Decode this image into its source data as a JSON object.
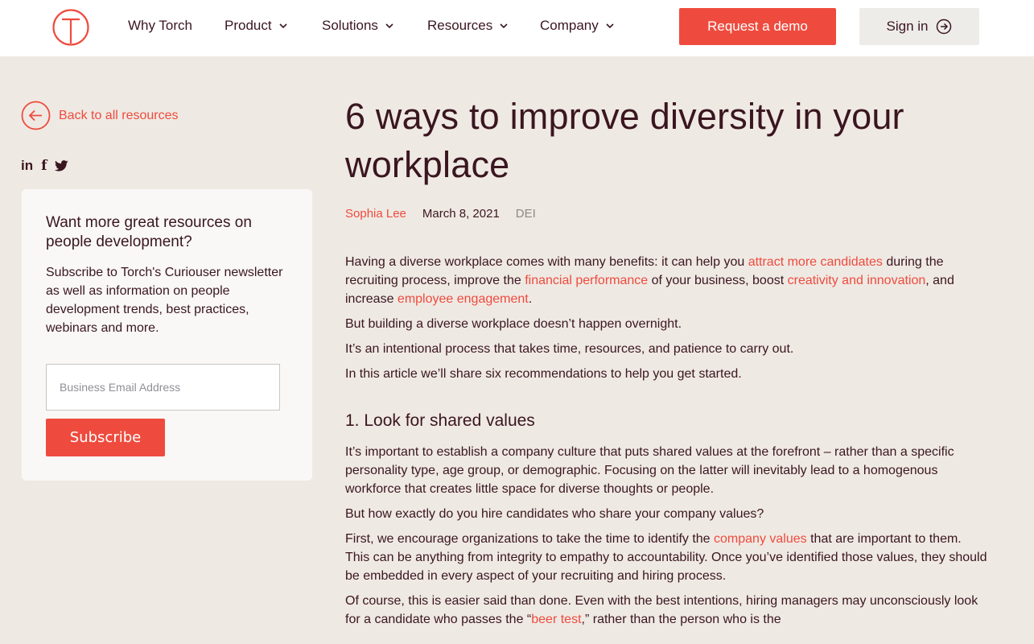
{
  "nav": {
    "items": [
      {
        "label": "Why Torch"
      },
      {
        "label": "Product"
      },
      {
        "label": "Solutions"
      },
      {
        "label": "Resources"
      },
      {
        "label": "Company"
      }
    ],
    "demo_label": "Request a demo",
    "signin_label": "Sign in",
    "logo_letter": "T"
  },
  "sidebar": {
    "back_label": "Back to all resources",
    "social": {
      "linkedin": "in",
      "facebook": "f",
      "twitter": "twitter-icon"
    },
    "card": {
      "heading": "Want more great resources on people development?",
      "text": "Subscribe to Torch's Curiouser newsletter as well as information on people development trends, best practices, webinars and more.",
      "email_placeholder": "Business Email Address",
      "subscribe_label": "Subscribe"
    }
  },
  "article": {
    "title": "6 ways to improve diversity in your workplace",
    "author": "Sophia Lee",
    "date": "March 8, 2021",
    "tag": "DEI",
    "intro": {
      "t1": "Having a diverse workplace comes with many benefits: it can help you ",
      "l1": "attract more candidates",
      "t2": " during the recruiting process, improve the ",
      "l2": "financial performance",
      "t3": " of your business, boost ",
      "l3": "creativity and innovation",
      "t4": ", and increase ",
      "l4": "employee engagement",
      "t5": "."
    },
    "p2": "But building a diverse workplace doesn’t happen overnight.",
    "p3": "It’s an intentional process that takes time, resources, and patience to carry out.",
    "p4": "In this article we’ll share six recommendations to help you get started.",
    "h1": "1. Look for shared values",
    "s1p1": "It’s important to establish a company culture that puts shared values at the forefront – rather than a specific personality type, age group, or demographic. Focusing on the latter will inevitably lead to a homogenous workforce that creates little space for diverse thoughts or people.",
    "s1p2": "But how exactly do you hire candidates who share your company values?",
    "s1p3": {
      "t1": "First, we encourage organizations to take the time to identify the ",
      "l1": "company values",
      "t2": " that are important to them. This can be anything from integrity to empathy to accountability. Once you’ve identified those values, they should be embedded in every aspect of your recruiting and hiring process."
    },
    "s1p4": {
      "t1": "Of course, this is easier said than done. Even with the best intentions, hiring managers may unconsciously look for a candidate who passes the “",
      "l1": "beer test",
      "t2": ",” rather than the person who is the"
    }
  },
  "colors": {
    "accent": "#ee4b3e",
    "text": "#3a1620",
    "background": "#efe9e3",
    "card": "#f9f8f6"
  }
}
